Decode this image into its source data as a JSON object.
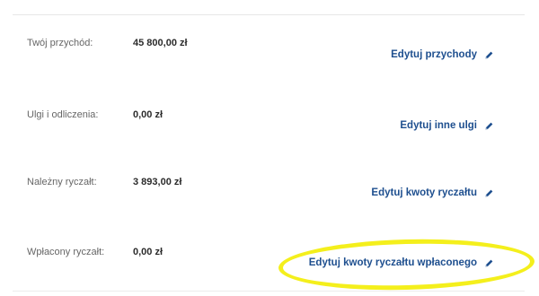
{
  "rows": [
    {
      "label": "Twój przychód:",
      "value": "45 800,00 zł",
      "action": "Edytuj przychody"
    },
    {
      "label": "Ulgi i odliczenia:",
      "value": "0,00 zł",
      "action": "Edytuj inne ulgi"
    },
    {
      "label": "Należny ryczałt:",
      "value": "3 893,00 zł",
      "action": "Edytuj kwoty ryczałtu"
    },
    {
      "label": "Wpłacony ryczałt:",
      "value": "0,00 zł",
      "action": "Edytuj kwoty ryczałtu wpłaconego"
    }
  ],
  "icons": {
    "edit": "pencil-icon"
  },
  "colors": {
    "link": "#1e4f8f",
    "label": "#666666",
    "value": "#2b2b2b",
    "highlight": "#f4ef1c"
  }
}
